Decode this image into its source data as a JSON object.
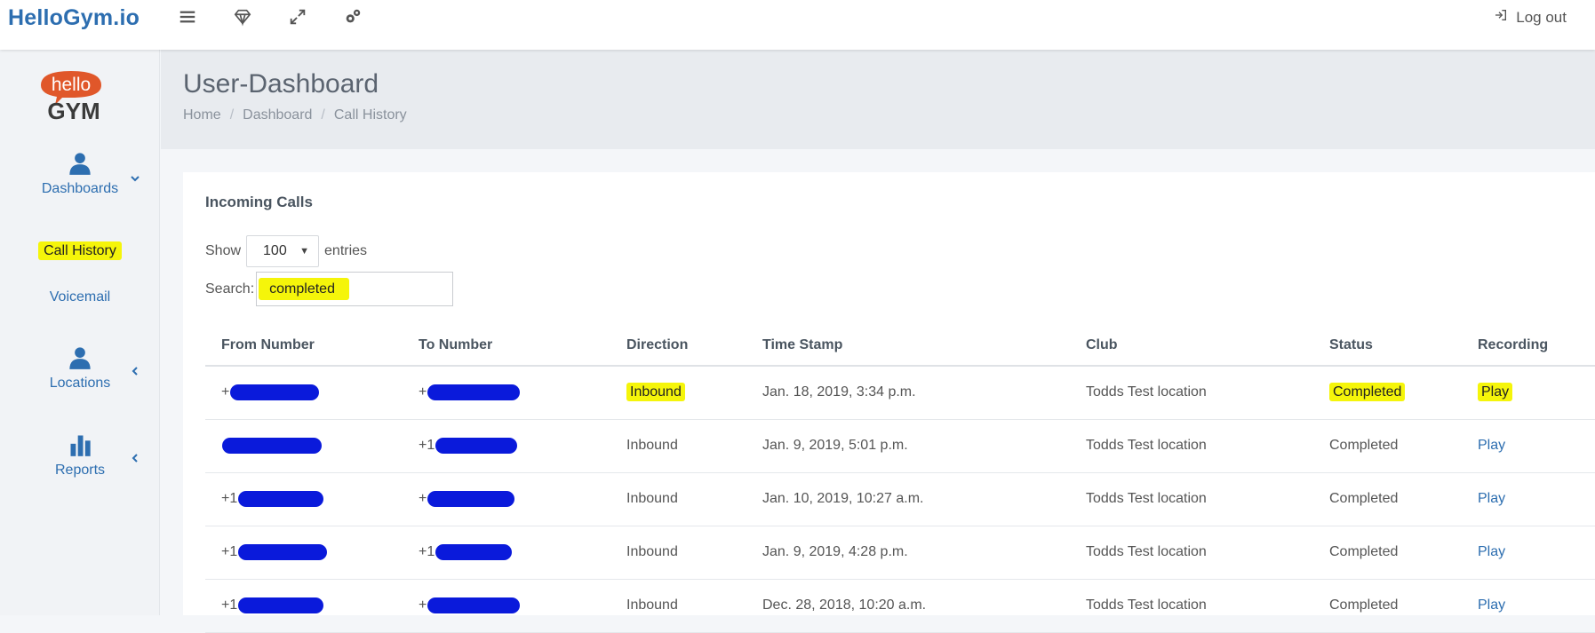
{
  "brand": "HelloGym.io",
  "topbar": {
    "icons": [
      "menu-icon",
      "diamond-icon",
      "expand-icon",
      "settings-icon"
    ],
    "logout_label": "Log out"
  },
  "logo": {
    "top": "hello",
    "bottom": "GYM"
  },
  "sidebar": {
    "items": [
      {
        "label": "Dashboards",
        "icon": "user-icon"
      },
      {
        "label": "Call History"
      },
      {
        "label": "Voicemail"
      },
      {
        "label": "Locations",
        "icon": "user-icon"
      },
      {
        "label": "Reports",
        "icon": "bar-chart-icon"
      }
    ]
  },
  "header": {
    "title": "User-Dashboard",
    "breadcrumb": [
      "Home",
      "Dashboard",
      "Call History"
    ]
  },
  "card": {
    "title": "Incoming Calls",
    "show_label": "Show",
    "entries_value": "100",
    "entries_label": "entries",
    "search_label": "Search:",
    "search_value": "completed"
  },
  "table": {
    "columns": [
      "From Number",
      "To Number",
      "Direction",
      "Time Stamp",
      "Club",
      "Status",
      "Recording"
    ],
    "rows": [
      {
        "from_prefix": "+",
        "to_prefix": "+",
        "direction": "Inbound",
        "timestamp": "Jan. 18, 2019, 3:34 p.m.",
        "club": "Todds Test location",
        "status": "Completed",
        "recording": "Play"
      },
      {
        "from_prefix": "",
        "to_prefix": "+1",
        "direction": "Inbound",
        "timestamp": "Jan. 9, 2019, 5:01 p.m.",
        "club": "Todds Test location",
        "status": "Completed",
        "recording": "Play"
      },
      {
        "from_prefix": "+1",
        "to_prefix": "+",
        "direction": "Inbound",
        "timestamp": "Jan. 10, 2019, 10:27 a.m.",
        "club": "Todds Test location",
        "status": "Completed",
        "recording": "Play"
      },
      {
        "from_prefix": "+1",
        "to_prefix": "+1",
        "direction": "Inbound",
        "timestamp": "Jan. 9, 2019, 4:28 p.m.",
        "club": "Todds Test location",
        "status": "Completed",
        "recording": "Play"
      },
      {
        "from_prefix": "+1",
        "to_prefix": "+",
        "direction": "Inbound",
        "timestamp": "Dec. 28, 2018, 10:20 a.m.",
        "club": "Todds Test location",
        "status": "Completed",
        "recording": "Play"
      }
    ]
  },
  "colors": {
    "accent": "#2d6eb0",
    "highlight": "#f5f50a",
    "redaction": "#0a1adb",
    "logo_orange": "#e0572a"
  }
}
